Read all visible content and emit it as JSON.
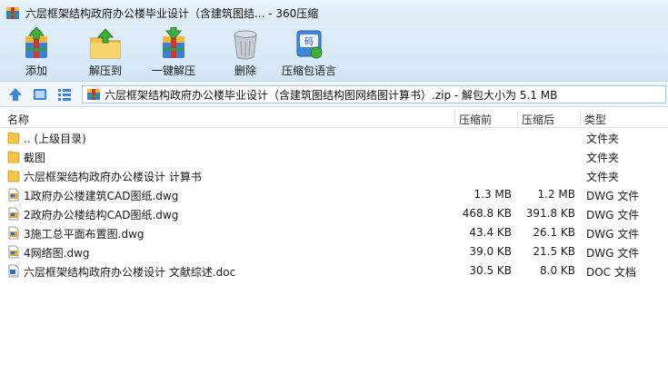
{
  "window": {
    "title": "六层框架结构政府办公楼毕业设计（含建筑图结... - 360压缩"
  },
  "toolbar": [
    {
      "label": "添加",
      "icon": "add-archive-icon"
    },
    {
      "label": "解压到",
      "icon": "extract-to-icon"
    },
    {
      "label": "一键解压",
      "icon": "one-click-extract-icon"
    },
    {
      "label": "删除",
      "icon": "delete-trash-icon"
    },
    {
      "label": "压缩包语言",
      "icon": "archive-language-icon"
    }
  ],
  "addressbar": {
    "path": "六层框架结构政府办公楼毕业设计（含建筑图结构图网络图计算书）.zip - 解包大小为 5.1 MB"
  },
  "list": {
    "headers": {
      "name": "名称",
      "compressed": "压缩前",
      "actual": "压缩后",
      "type": "类型"
    },
    "rows": [
      {
        "name": ".. (上级目录)",
        "compressed": "",
        "actual": "",
        "type": "文件夹",
        "icon": "folder-icon"
      },
      {
        "name": "截图",
        "compressed": "",
        "actual": "",
        "type": "文件夹",
        "icon": "folder-icon"
      },
      {
        "name": "六层框架结构政府办公楼设计 计算书",
        "compressed": "",
        "actual": "",
        "type": "文件夹",
        "icon": "folder-icon"
      },
      {
        "name": "1政府办公楼建筑CAD图纸.dwg",
        "compressed": "1.3 MB",
        "actual": "1.2 MB",
        "type": "DWG 文件",
        "icon": "dwg-file-icon"
      },
      {
        "name": "2政府办公楼结构CAD图纸.dwg",
        "compressed": "468.8 KB",
        "actual": "391.8 KB",
        "type": "DWG 文件",
        "icon": "dwg-file-icon"
      },
      {
        "name": "3施工总平面布置图.dwg",
        "compressed": "43.4 KB",
        "actual": "26.1 KB",
        "type": "DWG 文件",
        "icon": "dwg-file-icon"
      },
      {
        "name": "4网络图.dwg",
        "compressed": "39.0 KB",
        "actual": "21.5 KB",
        "type": "DWG 文件",
        "icon": "dwg-file-icon"
      },
      {
        "name": "六层框架结构政府办公楼设计 文献综述.doc",
        "compressed": "30.5 KB",
        "actual": "8.0 KB",
        "type": "DOC 文档",
        "icon": "doc-file-icon"
      }
    ]
  }
}
